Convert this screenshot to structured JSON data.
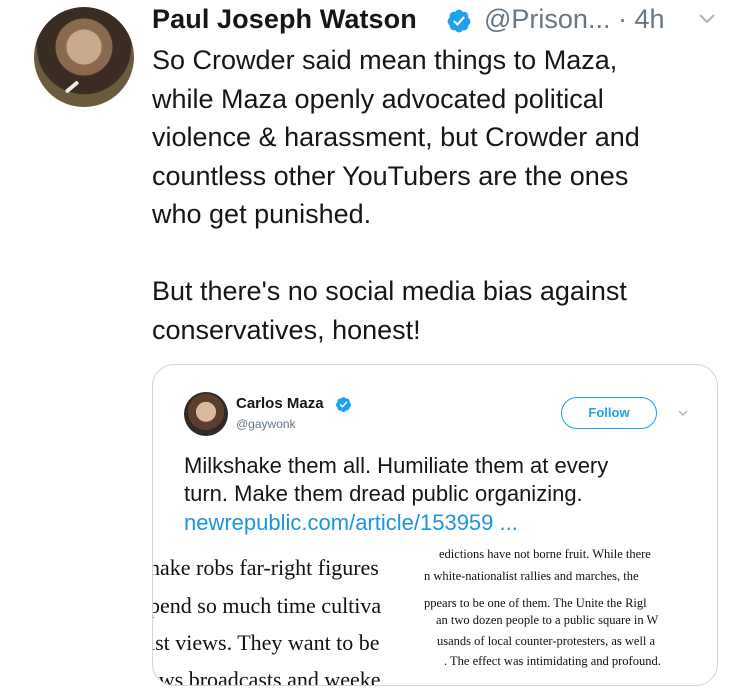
{
  "tweet": {
    "author_name": "Paul Joseph Watson",
    "handle": "@Prison...",
    "time": "· 4h",
    "paragraph_1": [
      "So Crowder said mean things to Maza,",
      "while Maza openly advocated political",
      "violence & harassment, but Crowder and",
      "countless other YouTubers are the ones",
      "who get punished."
    ],
    "paragraph_2": [
      "But there's no social media bias against",
      "conservatives, honest!"
    ]
  },
  "quoted": {
    "author_name": "Carlos Maza",
    "handle": "@gaywonk",
    "follow_label": "Follow",
    "text_lines": [
      "Milkshake them all. Humiliate them at every",
      "turn. Make them dread public organizing."
    ],
    "link": "newrepublic.com/article/153959 ...",
    "article_left": [
      "hake robs far-right figures",
      "pend so much time cultiva",
      "ist views. They want to be",
      "ews broadcasts and weeke"
    ],
    "article_right": [
      "edictions have not borne fruit. While there",
      "n white-nationalist rallies and marches, the",
      "ppears to be one of them. The Unite the Rigl",
      "an two dozen people to a public square in W",
      "usands of local counter-protesters, as well a",
      ". The effect was intimidating and profound."
    ]
  },
  "colors": {
    "verified": "#1da1f2",
    "link": "#1b95e0",
    "muted": "#657786"
  }
}
